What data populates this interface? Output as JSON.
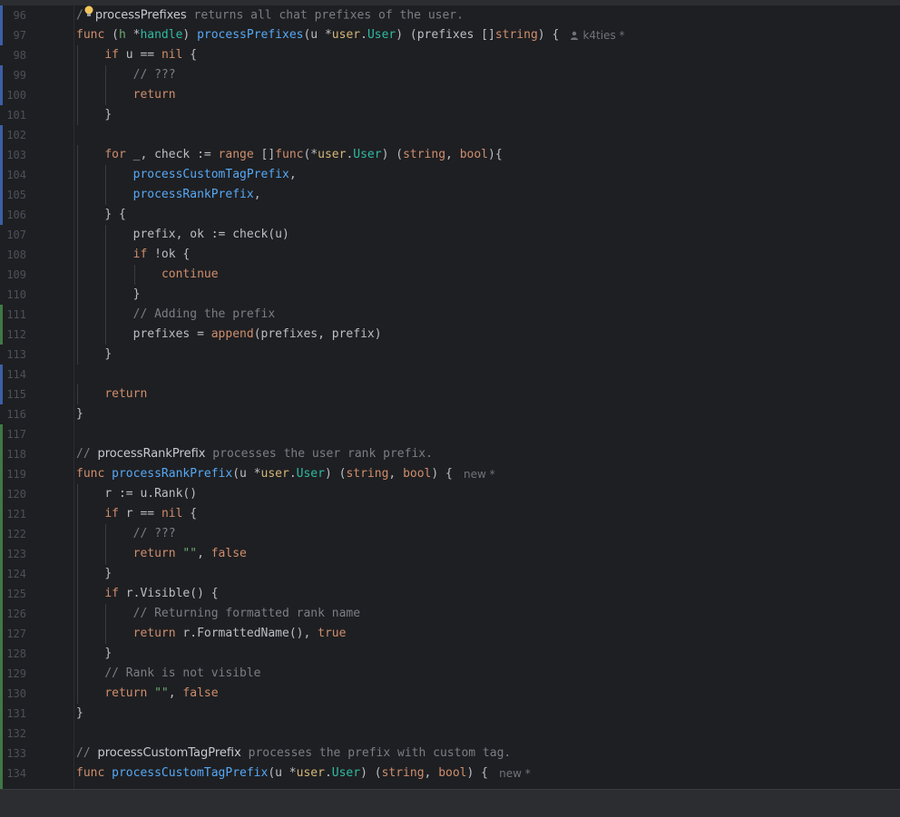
{
  "editor": {
    "lines": [
      {
        "n": "96",
        "marker": "blue",
        "indent": 0,
        "segments": [
          [
            "/",
            "comment"
          ],
          [
            "processPrefixes",
            "doc"
          ],
          [
            " returns all chat prefixes of the user.",
            "comment"
          ]
        ],
        "bulb": true
      },
      {
        "n": "97",
        "marker": "blue",
        "indent": 0,
        "segments": [
          [
            "func",
            "kw"
          ],
          [
            " (",
            "plain"
          ],
          [
            "h",
            "param"
          ],
          [
            " *",
            "plain"
          ],
          [
            "handle",
            "type"
          ],
          [
            ") ",
            "plain"
          ],
          [
            "processPrefixes",
            "fn"
          ],
          [
            "(u *",
            "plain"
          ],
          [
            "user",
            "pkg"
          ],
          [
            ".",
            "plain"
          ],
          [
            "User",
            "type"
          ],
          [
            ") (prefixes []",
            "plain"
          ],
          [
            "string",
            "kw"
          ],
          [
            ") {",
            "plain"
          ]
        ],
        "hint": {
          "text": "k4ties *",
          "icon": true
        }
      },
      {
        "n": "98",
        "marker": "none",
        "indent": 1,
        "segments": [
          [
            "if",
            "kw"
          ],
          [
            " u == ",
            "plain"
          ],
          [
            "nil",
            "kw"
          ],
          [
            " {",
            "plain"
          ]
        ]
      },
      {
        "n": "99",
        "marker": "blue",
        "indent": 2,
        "segments": [
          [
            "// ???",
            "comment"
          ]
        ]
      },
      {
        "n": "100",
        "marker": "blue",
        "indent": 2,
        "segments": [
          [
            "return",
            "kw"
          ]
        ]
      },
      {
        "n": "101",
        "marker": "none",
        "indent": 1,
        "segments": [
          [
            "}",
            "plain"
          ]
        ]
      },
      {
        "n": "102",
        "marker": "blue",
        "indent": 0,
        "segments": []
      },
      {
        "n": "103",
        "marker": "blue",
        "indent": 1,
        "segments": [
          [
            "for",
            "kw"
          ],
          [
            " _, check := ",
            "plain"
          ],
          [
            "range",
            "kw"
          ],
          [
            " []",
            "plain"
          ],
          [
            "func",
            "kw"
          ],
          [
            "(*",
            "plain"
          ],
          [
            "user",
            "pkg"
          ],
          [
            ".",
            "plain"
          ],
          [
            "User",
            "type"
          ],
          [
            ") (",
            "plain"
          ],
          [
            "string",
            "kw"
          ],
          [
            ", ",
            "plain"
          ],
          [
            "bool",
            "kw"
          ],
          [
            "){",
            "plain"
          ]
        ]
      },
      {
        "n": "104",
        "marker": "blue",
        "indent": 2,
        "segments": [
          [
            "processCustomTagPrefix",
            "fn"
          ],
          [
            ",",
            "plain"
          ]
        ]
      },
      {
        "n": "105",
        "marker": "blue",
        "indent": 2,
        "segments": [
          [
            "processRankPrefix",
            "fn"
          ],
          [
            ",",
            "plain"
          ]
        ]
      },
      {
        "n": "106",
        "marker": "blue",
        "indent": 1,
        "segments": [
          [
            "} {",
            "plain"
          ]
        ]
      },
      {
        "n": "107",
        "marker": "none",
        "indent": 2,
        "segments": [
          [
            "prefix, ok := check(u)",
            "plain"
          ]
        ]
      },
      {
        "n": "108",
        "marker": "none",
        "indent": 2,
        "segments": [
          [
            "if",
            "kw"
          ],
          [
            " !ok {",
            "plain"
          ]
        ]
      },
      {
        "n": "109",
        "marker": "none",
        "indent": 3,
        "segments": [
          [
            "continue",
            "kw"
          ]
        ]
      },
      {
        "n": "110",
        "marker": "none",
        "indent": 2,
        "segments": [
          [
            "}",
            "plain"
          ]
        ]
      },
      {
        "n": "111",
        "marker": "green",
        "indent": 2,
        "segments": [
          [
            "// Adding the prefix",
            "comment"
          ]
        ]
      },
      {
        "n": "112",
        "marker": "green",
        "indent": 2,
        "segments": [
          [
            "prefixes = ",
            "plain"
          ],
          [
            "append",
            "fnc"
          ],
          [
            "(prefixes, prefix)",
            "plain"
          ]
        ]
      },
      {
        "n": "113",
        "marker": "none",
        "indent": 1,
        "segments": [
          [
            "}",
            "plain"
          ]
        ]
      },
      {
        "n": "114",
        "marker": "blue",
        "indent": 0,
        "segments": []
      },
      {
        "n": "115",
        "marker": "blue",
        "indent": 1,
        "segments": [
          [
            "return",
            "kw"
          ]
        ]
      },
      {
        "n": "116",
        "marker": "none",
        "indent": 0,
        "segments": [
          [
            "}",
            "plain"
          ]
        ]
      },
      {
        "n": "117",
        "marker": "green",
        "indent": 0,
        "segments": []
      },
      {
        "n": "118",
        "marker": "green",
        "indent": 0,
        "segments": [
          [
            "// ",
            "comment"
          ],
          [
            "processRankPrefix",
            "doc"
          ],
          [
            " processes the user rank prefix.",
            "comment"
          ]
        ]
      },
      {
        "n": "119",
        "marker": "green",
        "indent": 0,
        "segments": [
          [
            "func",
            "kw"
          ],
          [
            " ",
            "plain"
          ],
          [
            "processRankPrefix",
            "fn"
          ],
          [
            "(u *",
            "plain"
          ],
          [
            "user",
            "pkg"
          ],
          [
            ".",
            "plain"
          ],
          [
            "User",
            "type"
          ],
          [
            ") (",
            "plain"
          ],
          [
            "string",
            "kw"
          ],
          [
            ", ",
            "plain"
          ],
          [
            "bool",
            "kw"
          ],
          [
            ") {",
            "plain"
          ]
        ],
        "hint": {
          "text": "new *",
          "icon": false
        }
      },
      {
        "n": "120",
        "marker": "green",
        "indent": 1,
        "segments": [
          [
            "r := u.",
            "plain"
          ],
          [
            "Rank",
            "method"
          ],
          [
            "()",
            "plain"
          ]
        ]
      },
      {
        "n": "121",
        "marker": "green",
        "indent": 1,
        "segments": [
          [
            "if",
            "kw"
          ],
          [
            " r == ",
            "plain"
          ],
          [
            "nil",
            "kw"
          ],
          [
            " {",
            "plain"
          ]
        ]
      },
      {
        "n": "122",
        "marker": "green",
        "indent": 2,
        "segments": [
          [
            "// ???",
            "comment"
          ]
        ]
      },
      {
        "n": "123",
        "marker": "green",
        "indent": 2,
        "segments": [
          [
            "return",
            "kw"
          ],
          [
            " ",
            "plain"
          ],
          [
            "\"\"",
            "str"
          ],
          [
            ", ",
            "plain"
          ],
          [
            "false",
            "kw"
          ]
        ]
      },
      {
        "n": "124",
        "marker": "green",
        "indent": 1,
        "segments": [
          [
            "}",
            "plain"
          ]
        ]
      },
      {
        "n": "125",
        "marker": "green",
        "indent": 1,
        "segments": [
          [
            "if",
            "kw"
          ],
          [
            " r.",
            "plain"
          ],
          [
            "Visible",
            "method"
          ],
          [
            "() {",
            "plain"
          ]
        ]
      },
      {
        "n": "126",
        "marker": "green",
        "indent": 2,
        "segments": [
          [
            "// Returning formatted rank name",
            "comment"
          ]
        ]
      },
      {
        "n": "127",
        "marker": "green",
        "indent": 2,
        "segments": [
          [
            "return",
            "kw"
          ],
          [
            " r.",
            "plain"
          ],
          [
            "FormattedName",
            "method"
          ],
          [
            "(), ",
            "plain"
          ],
          [
            "true",
            "kw"
          ]
        ]
      },
      {
        "n": "128",
        "marker": "green",
        "indent": 1,
        "segments": [
          [
            "}",
            "plain"
          ]
        ]
      },
      {
        "n": "129",
        "marker": "green",
        "indent": 1,
        "segments": [
          [
            "// Rank is not visible",
            "comment"
          ]
        ]
      },
      {
        "n": "130",
        "marker": "green",
        "indent": 1,
        "segments": [
          [
            "return",
            "kw"
          ],
          [
            " ",
            "plain"
          ],
          [
            "\"\"",
            "str"
          ],
          [
            ", ",
            "plain"
          ],
          [
            "false",
            "kw"
          ]
        ]
      },
      {
        "n": "131",
        "marker": "green",
        "indent": 0,
        "segments": [
          [
            "}",
            "plain"
          ]
        ]
      },
      {
        "n": "132",
        "marker": "green",
        "indent": 0,
        "segments": []
      },
      {
        "n": "133",
        "marker": "green",
        "indent": 0,
        "segments": [
          [
            "// ",
            "comment"
          ],
          [
            "processCustomTagPrefix",
            "doc"
          ],
          [
            " processes the prefix with custom tag.",
            "comment"
          ]
        ]
      },
      {
        "n": "134",
        "marker": "green",
        "indent": 0,
        "segments": [
          [
            "func",
            "kw"
          ],
          [
            " ",
            "plain"
          ],
          [
            "processCustomTagPrefix",
            "fn"
          ],
          [
            "(u *",
            "plain"
          ],
          [
            "user",
            "pkg"
          ],
          [
            ".",
            "plain"
          ],
          [
            "User",
            "type"
          ],
          [
            ") (",
            "plain"
          ],
          [
            "string",
            "kw"
          ],
          [
            ", ",
            "plain"
          ],
          [
            "bool",
            "kw"
          ],
          [
            ") {",
            "plain"
          ]
        ],
        "hint": {
          "text": "new *",
          "icon": false
        }
      }
    ]
  },
  "colors": {
    "plain": "#bcbec4",
    "kw": "#cf8e6d",
    "fn": "#56a8f5",
    "fnc": "#cf8e6d",
    "method": "#bcbec4",
    "comment": "#7a7e85",
    "doc": "#c7cad1",
    "type": "#2fbaa3",
    "pkg": "#d5b778",
    "param": "#6aab73",
    "str": "#6aab73",
    "marker_blue": "#3d5fa8",
    "marker_green": "#3e7a45",
    "background": "#1e1f22",
    "gutter_number": "#4b5059",
    "hint": "#6f737a",
    "bulb": "#f2c55c"
  }
}
